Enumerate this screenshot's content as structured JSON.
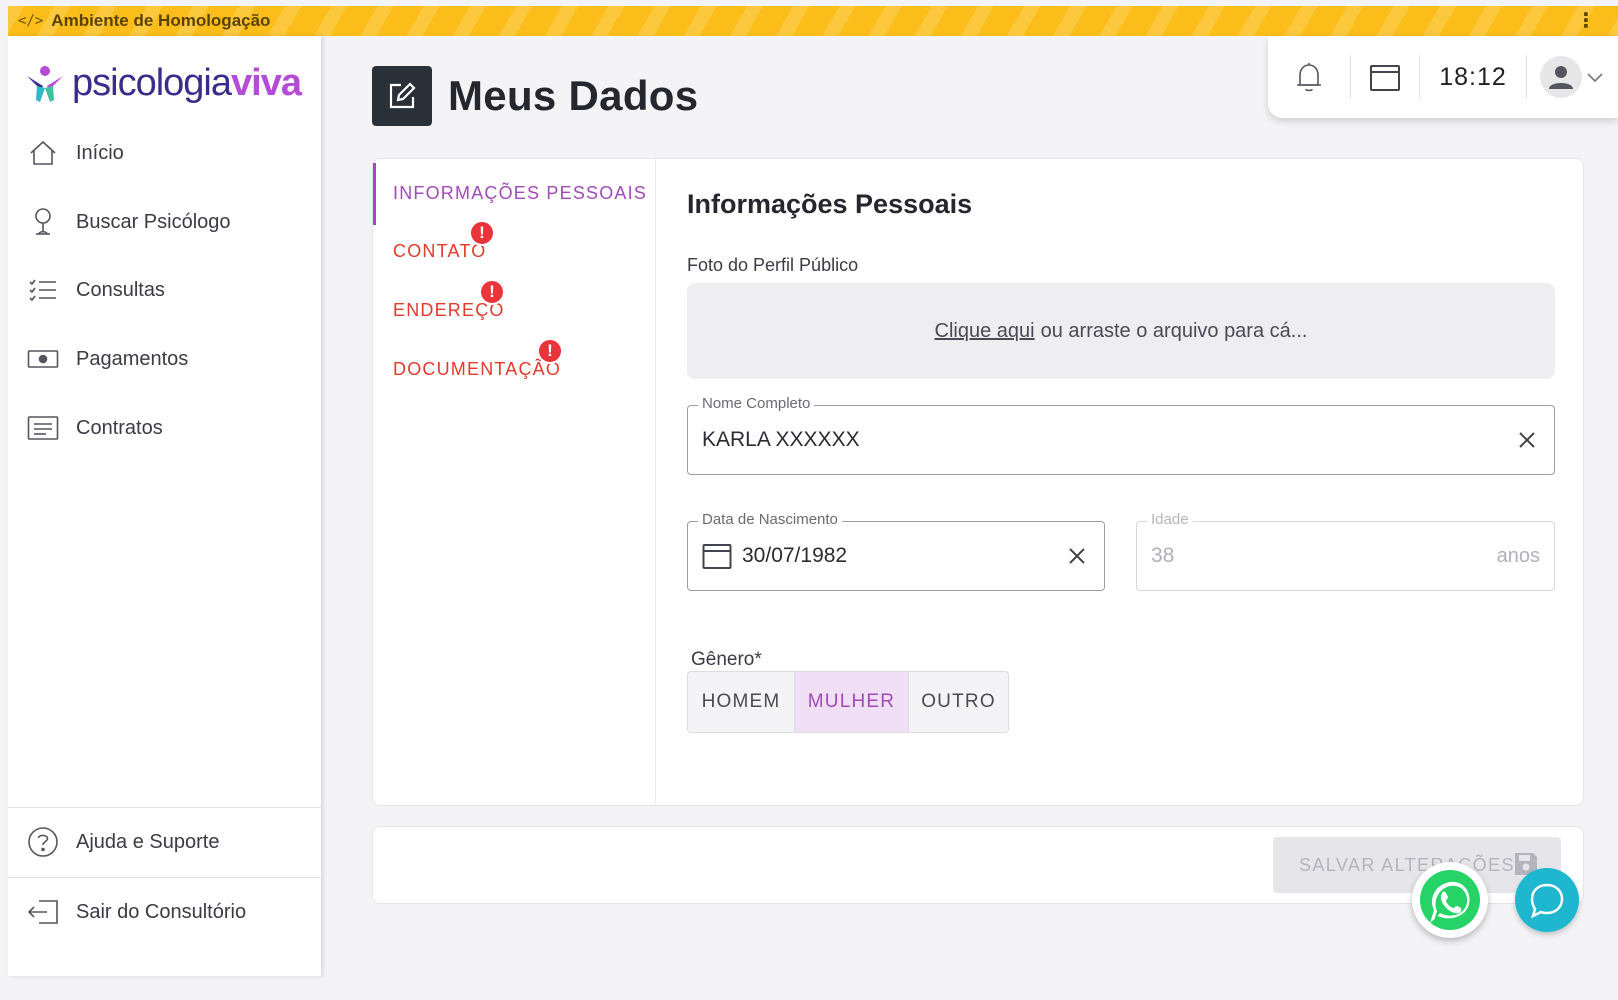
{
  "env_banner": {
    "text": "Ambiente de Homologação",
    "color": "#fbbd19"
  },
  "brand": {
    "logo_part1": "psicologia",
    "logo_part2": "viva",
    "colors": [
      "#3a2c8c",
      "#b54bd6"
    ]
  },
  "sidebar": {
    "items": [
      {
        "label": "Início",
        "icon": "home-icon"
      },
      {
        "label": "Buscar Psicólogo",
        "icon": "location-pin-icon"
      },
      {
        "label": "Consultas",
        "icon": "list-icon"
      },
      {
        "label": "Pagamentos",
        "icon": "money-icon"
      },
      {
        "label": "Contratos",
        "icon": "document-icon"
      }
    ],
    "bottom_items": [
      {
        "label": "Ajuda e Suporte",
        "icon": "help-icon"
      },
      {
        "label": "Sair do Consultório",
        "icon": "logout-icon"
      }
    ]
  },
  "header": {
    "title": "Meus Dados",
    "icon": "edit-icon"
  },
  "topbar": {
    "time": "18:12",
    "icons": [
      "bell-icon",
      "calendar-icon",
      "user-icon",
      "chevron-down-icon"
    ]
  },
  "tabs": [
    {
      "label": "INFORMAÇÕES PESSOAIS",
      "active": true,
      "error": false
    },
    {
      "label": "CONTATO",
      "active": false,
      "error": true
    },
    {
      "label": "ENDEREÇO",
      "active": false,
      "error": true
    },
    {
      "label": "DOCUMENTAÇÃO",
      "active": false,
      "error": true
    }
  ],
  "error_badge": "!",
  "form": {
    "section_title": "Informações Pessoais",
    "photo": {
      "label": "Foto do Perfil Público",
      "link_text": "Clique aqui",
      "rest_text": "ou arraste o arquivo para cá..."
    },
    "nome": {
      "label": "Nome Completo",
      "value": "KARLA XXXXXX"
    },
    "nascimento": {
      "label": "Data de Nascimento",
      "value": "30/07/1982"
    },
    "idade": {
      "label": "Idade",
      "value": "38",
      "suffix": "anos"
    },
    "genero": {
      "label": "Gênero*",
      "options": [
        "HOMEM",
        "MULHER",
        "OUTRO"
      ],
      "selected": "MULHER"
    }
  },
  "footer": {
    "save_label": "SALVAR ALTERAÇÕES"
  },
  "accent": "#a24bb8",
  "error_color": "#e23a2b"
}
